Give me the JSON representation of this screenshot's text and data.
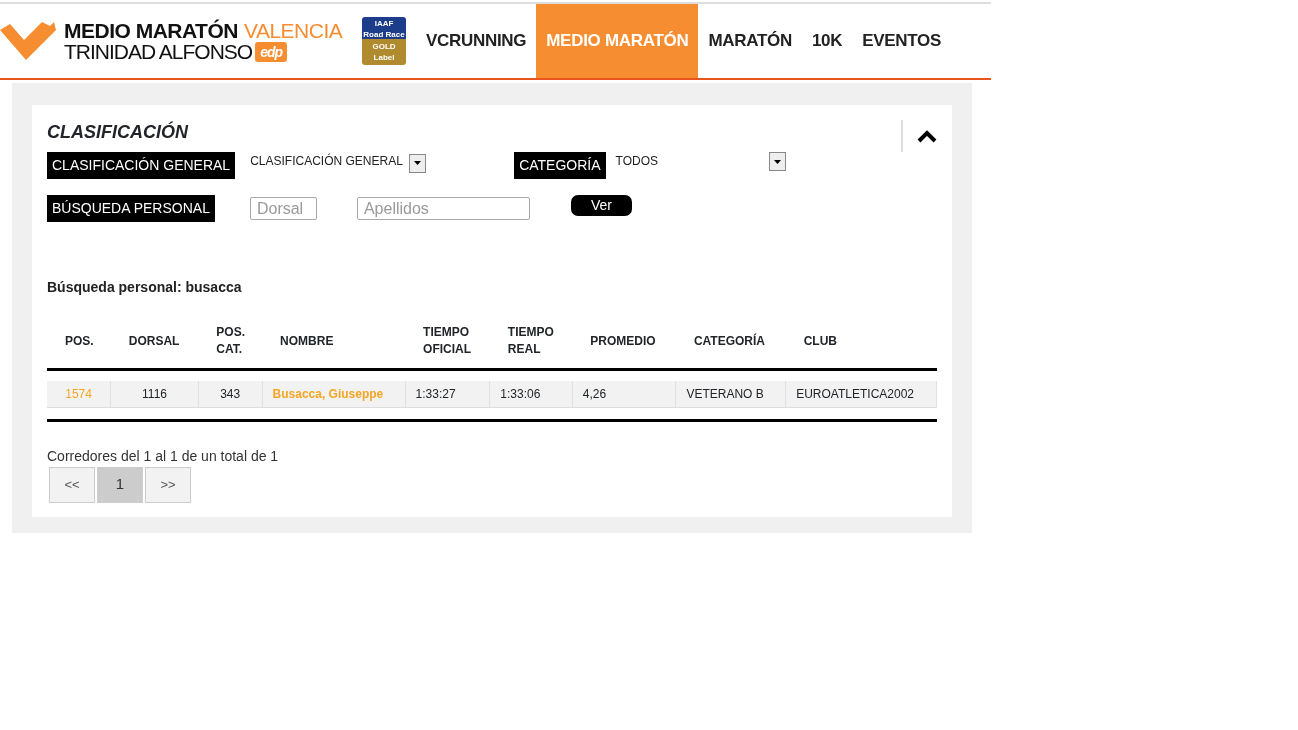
{
  "header": {
    "logo": {
      "line1_bold": "MEDIO MARATÓN",
      "line1_color": "VALENCIA",
      "line2": "TRINIDAD ALFONSO",
      "tag": "edp"
    },
    "badge": {
      "lines": [
        "IAAF",
        "Road Race",
        "GOLD",
        "Label"
      ]
    },
    "nav": [
      {
        "label": "VCRUNNING",
        "selected": false
      },
      {
        "label": "MEDIO MARATÓN",
        "selected": true
      },
      {
        "label": "MARATÓN",
        "selected": false
      },
      {
        "label": "10K",
        "selected": false
      },
      {
        "label": "EVENTOS",
        "selected": false
      }
    ]
  },
  "panel": {
    "title": "CLASIFICACIÓN",
    "expanded": true,
    "filters": {
      "general_label": "CLASIFICACIÓN GENERAL",
      "general_value": "CLASIFICACIÓN GENERAL",
      "category_label": "CATEGORÍA",
      "category_value": "TODOS",
      "search_label": "BÚSQUEDA PERSONAL",
      "dorsal_placeholder": "Dorsal",
      "surname_placeholder": "Apellidos",
      "button": "Ver"
    },
    "search_caption": "Búsqueda personal: busacca",
    "table": {
      "columns": [
        "POS.",
        "DORSAL",
        "POS.\nCAT.",
        "NOMBRE",
        "TIEMPO\nOFICIAL",
        "TIEMPO\nREAL",
        "PROMEDIO",
        "CATEGORÍA",
        "CLUB"
      ],
      "rows": [
        {
          "cells": [
            "1574",
            "1116",
            "343",
            "Busacca, Giuseppe",
            "1:33:27",
            "1:33:06",
            "4,26",
            "VETERANO B",
            "EUROATLETICA2002"
          ]
        }
      ]
    },
    "summary": "Corredores del 1 al 1 de un total de 1",
    "pagination": [
      {
        "label": "<<",
        "selected": false
      },
      {
        "label": "1",
        "selected": true
      },
      {
        "label": ">>",
        "selected": false
      }
    ]
  }
}
